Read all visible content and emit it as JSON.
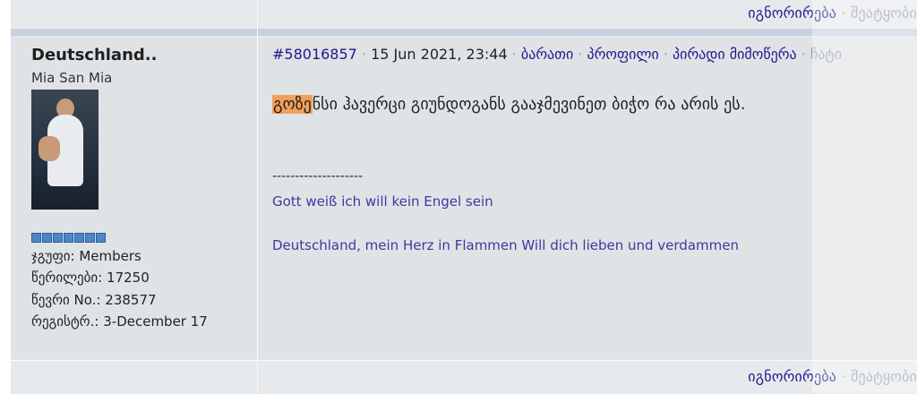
{
  "top_actions": {
    "ignore": "იგნორირება",
    "quote": "შეატყობი"
  },
  "author": {
    "name": "Deutschland..",
    "title": "Mia San Mia",
    "group_label": "ჯგუფი:",
    "group_value": "Members",
    "posts_label": "წერილები:",
    "posts_value": "17250",
    "member_no_label": "წევრი No.:",
    "member_no_value": "238577",
    "registered_label": "რეგისტრ.:",
    "registered_value": "3-December 17",
    "rank_pips": 7
  },
  "post": {
    "id": "#58016857",
    "date": "15 Jun 2021, 23:44",
    "links": [
      "ბარათი",
      "პროფილი",
      "პირადი მიმოწერა",
      "ჩატი"
    ],
    "message_highlight": "გოზე",
    "message_rest": "ნსი ჰავერცი გიუნდოგანს გააჯმევინეთ ბიჭო რა არის ეს.",
    "divider": "--------------------",
    "signature_line1": "Gott weiß ich will kein Engel sein",
    "signature_line2": "Deutschland, mein Herz in Flammen Will dich lieben und verdammen"
  },
  "bottom_actions": {
    "ignore": "იგნორირება",
    "quote": "შეატყობი"
  },
  "colors": {
    "link": "#1a1a8c",
    "highlight": "#f0a05a",
    "separator": "#c5d1df",
    "pip": "#4b86c8"
  }
}
